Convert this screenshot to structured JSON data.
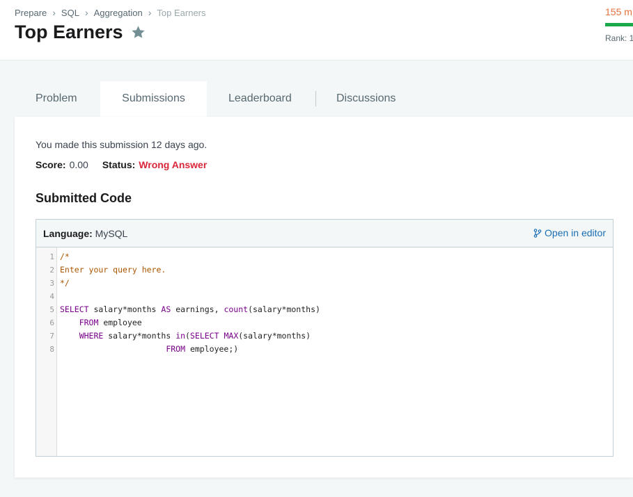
{
  "breadcrumb": {
    "items": [
      "Prepare",
      "SQL",
      "Aggregation"
    ],
    "current": "Top Earners"
  },
  "header": {
    "title": "Top Earners",
    "points": "155 m",
    "rank": "Rank: 1"
  },
  "tabs": [
    {
      "label": "Problem"
    },
    {
      "label": "Submissions"
    },
    {
      "label": "Leaderboard"
    },
    {
      "label": "Discussions"
    }
  ],
  "submission": {
    "made_text": "You made this submission 12 days ago.",
    "score_label": "Score:",
    "score_value": "0.00",
    "status_label": "Status:",
    "status_value": "Wrong Answer",
    "section_title": "Submitted Code"
  },
  "code_box": {
    "language_label": "Language:",
    "language_value": "MySQL",
    "open_editor": "Open in editor",
    "line_numbers": [
      "1",
      "2",
      "3",
      "4",
      "5",
      "6",
      "7",
      "8"
    ],
    "lines": [
      "/*",
      "Enter your query here.",
      "*/",
      "",
      "SELECT salary*months AS earnings, count(salary*months)",
      "    FROM employee",
      "    WHERE salary*months in(SELECT MAX(salary*months)",
      "                      FROM employee;)"
    ]
  },
  "colors": {
    "accent_green": "#1ba94c",
    "points_orange": "#e5713d",
    "wrong_red": "#d9263a",
    "link_blue": "#1a6eb5",
    "comment": "#aa5500",
    "keyword": "#770088"
  },
  "icons": [
    "chevron-right-icon",
    "star-icon",
    "branch-icon"
  ]
}
